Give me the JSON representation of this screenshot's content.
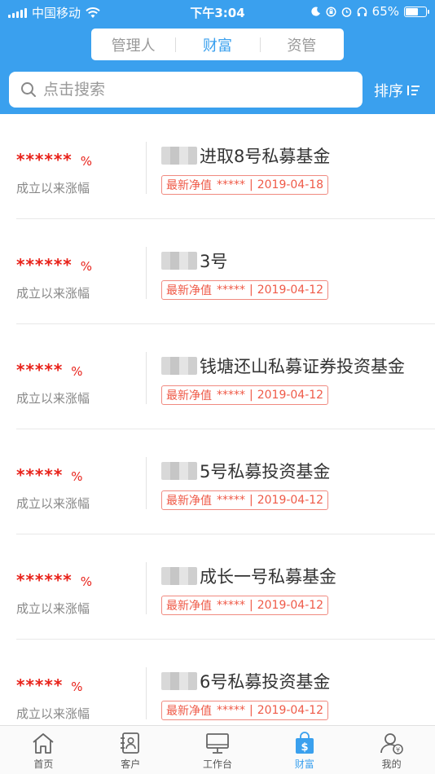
{
  "status_bar": {
    "carrier": "中国移动",
    "time": "下午3:04",
    "battery_percent": "65%",
    "battery_level": 0.65
  },
  "segment_tabs": [
    "管理人",
    "财富",
    "资管"
  ],
  "active_segment": 1,
  "search": {
    "placeholder": "点击搜索"
  },
  "sort": {
    "label": "排序"
  },
  "funds": [
    {
      "stars": "******",
      "pct": "%",
      "growth_label": "成立以来涨幅",
      "name": "进取8号私募基金",
      "nav_label": "最新净值",
      "nav_value": "*****",
      "date": "2019-04-18"
    },
    {
      "stars": "******",
      "pct": "%",
      "growth_label": "成立以来涨幅",
      "name": "3号",
      "nav_label": "最新净值",
      "nav_value": "*****",
      "date": "2019-04-12"
    },
    {
      "stars": "*****",
      "pct": "%",
      "growth_label": "成立以来涨幅",
      "name": "钱塘还山私募证券投资基金",
      "nav_label": "最新净值",
      "nav_value": "*****",
      "date": "2019-04-12"
    },
    {
      "stars": "*****",
      "pct": "%",
      "growth_label": "成立以来涨幅",
      "name": "5号私募投资基金",
      "nav_label": "最新净值",
      "nav_value": "*****",
      "date": "2019-04-12"
    },
    {
      "stars": "******",
      "pct": "%",
      "growth_label": "成立以来涨幅",
      "name": "成长一号私募基金",
      "nav_label": "最新净值",
      "nav_value": "*****",
      "date": "2019-04-12"
    },
    {
      "stars": "*****",
      "pct": "%",
      "growth_label": "成立以来涨幅",
      "name": "6号私募投资基金",
      "nav_label": "最新净值",
      "nav_value": "*****",
      "date": "2019-04-12"
    }
  ],
  "bottom_tabs": [
    {
      "label": "首页",
      "icon": "home-icon"
    },
    {
      "label": "客户",
      "icon": "contacts-icon"
    },
    {
      "label": "工作台",
      "icon": "monitor-icon"
    },
    {
      "label": "财富",
      "icon": "wealth-bag-icon"
    },
    {
      "label": "我的",
      "icon": "profile-icon"
    }
  ],
  "active_tab": 3,
  "colors": {
    "brand_blue": "#3aa0ee",
    "accent_red": "#e8221a",
    "tag_red": "#ef5a48"
  }
}
